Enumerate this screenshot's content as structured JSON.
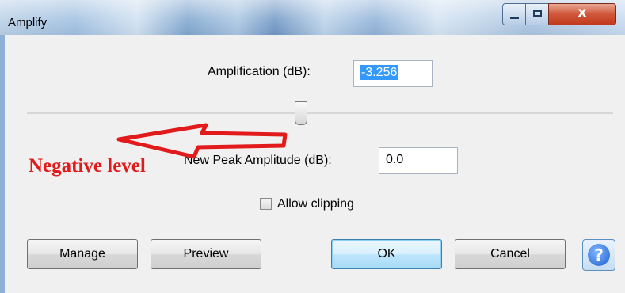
{
  "window": {
    "title": "Amplify",
    "close_glyph": "x"
  },
  "amplification": {
    "label": "Amplification (dB):",
    "value": "-3.256",
    "slider_level": 0.46
  },
  "peak": {
    "label": "New Peak Amplitude (dB):",
    "value": "0.0"
  },
  "clipping": {
    "label": "Allow clipping",
    "checked": false
  },
  "buttons": {
    "manage": "Manage",
    "preview": "Preview",
    "ok": "OK",
    "cancel": "Cancel",
    "help_glyph": "?"
  },
  "annotation": {
    "text": "Negative level",
    "color": "#e11b1b",
    "icon": "left-arrow-icon"
  }
}
